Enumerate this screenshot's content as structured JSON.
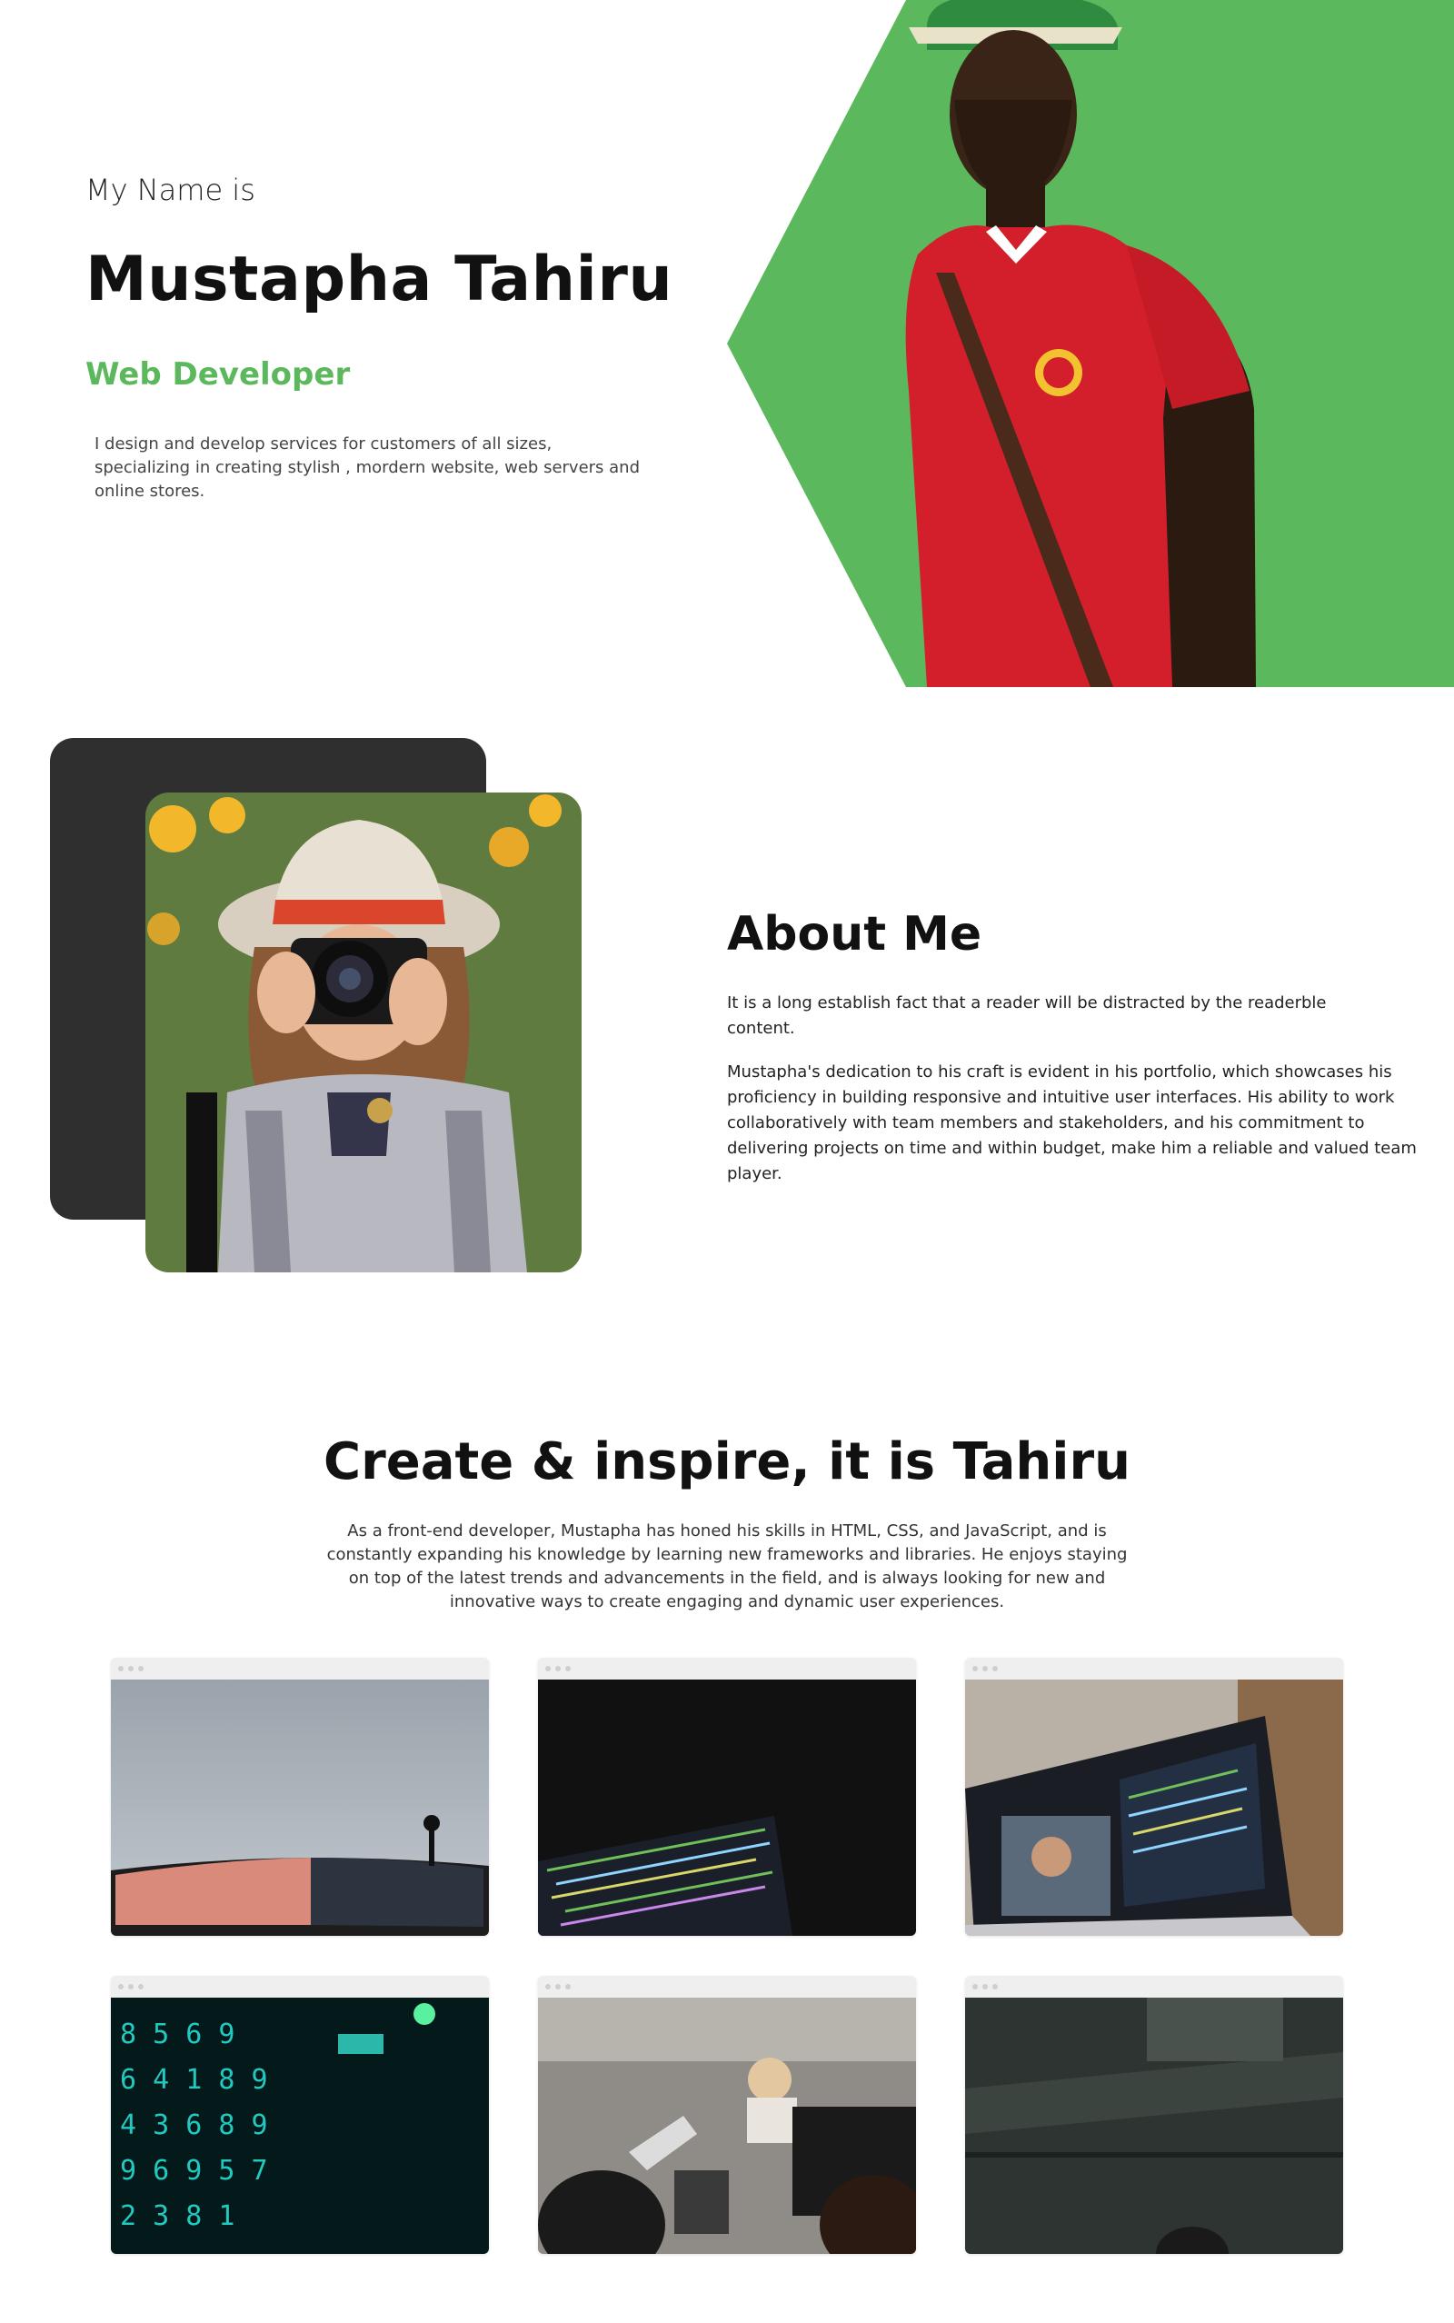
{
  "hero": {
    "intro": "My Name is",
    "name": "Mustapha Tahiru",
    "role": "Web Developer",
    "description": "I design and develop services for customers of all sizes, specializing in creating stylish , mordern website, web servers and online stores."
  },
  "about": {
    "title": "About Me",
    "paragraph1": "It is a long establish fact that a reader will be distracted by the readerble content.",
    "paragraph2": "Mustapha's dedication to his craft is evident in his portfolio, which showcases his proficiency in building responsive and intuitive user interfaces. His ability to work collaboratively with team members and stakeholders, and his commitment to delivering projects on time and within budget, make him a reliable and valued team player."
  },
  "create": {
    "title": "Create & inspire, it is Tahiru",
    "description": "As a front-end developer, Mustapha has honed his skills in HTML, CSS, and JavaScript, and is constantly expanding his knowledge by learning new frameworks and libraries. He enjoys staying on top of the latest trends and advancements in the field, and is always looking for new and innovative ways to create engaging and dynamic user experiences."
  },
  "colors": {
    "accent": "#5cb85c",
    "dark_panel": "#2f2f2f"
  }
}
